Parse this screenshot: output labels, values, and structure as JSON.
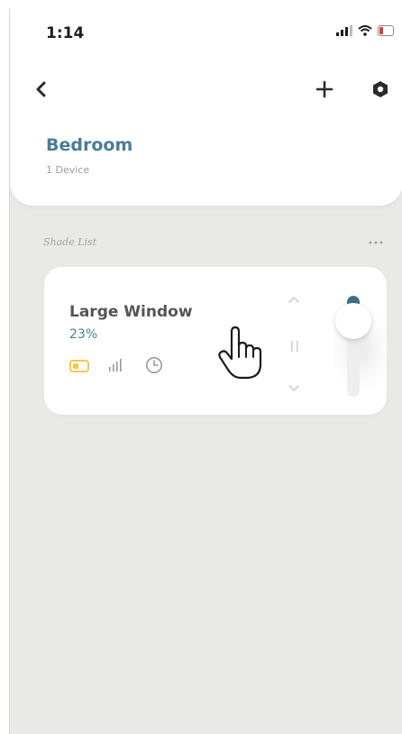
{
  "status_bar": {
    "time": "1:14"
  },
  "header": {
    "back_icon": "chevron-left-icon",
    "add_icon": "plus-icon",
    "settings_icon": "hexagon-settings-icon"
  },
  "room": {
    "title": "Bedroom",
    "subtitle": "1 Device"
  },
  "shade_list": {
    "label": "Shade List",
    "more_icon": "ellipsis-icon",
    "items": [
      {
        "name": "Large Window",
        "percent_label": "23%",
        "position_fraction": 0.23,
        "battery_color": "#f2c94c",
        "icons": [
          "battery-icon",
          "signal-icon",
          "clock-icon"
        ]
      }
    ]
  },
  "colors": {
    "accent": "#4a7d97",
    "slider_fill": "#3e6f86",
    "background": "#e9e9e5"
  }
}
